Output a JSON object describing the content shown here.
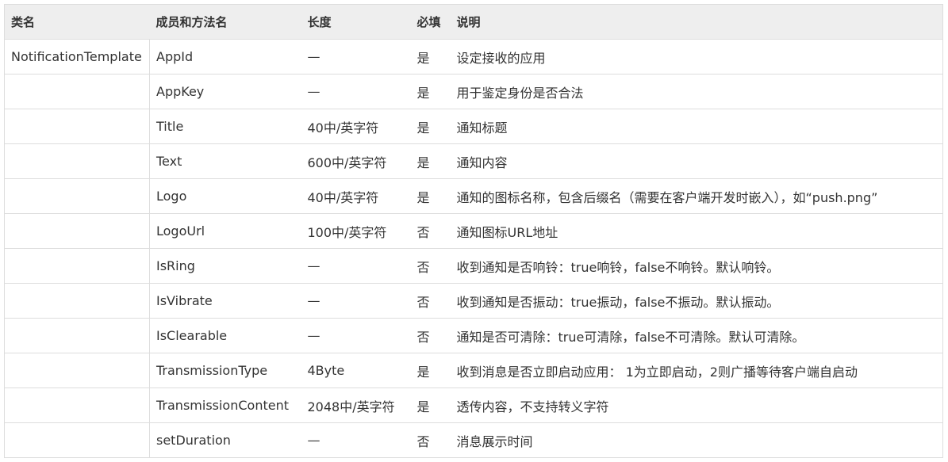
{
  "table": {
    "headers": [
      "类名",
      "成员和方法名",
      "长度",
      "必填",
      "说明"
    ],
    "rows": [
      {
        "class": "NotificationTemplate",
        "member": "AppId",
        "length": "—",
        "required": "是",
        "desc": "设定接收的应用"
      },
      {
        "class": "",
        "member": "AppKey",
        "length": "—",
        "required": "是",
        "desc": "用于鉴定身份是否合法"
      },
      {
        "class": "",
        "member": "Title",
        "length": "40中/英字符",
        "required": "是",
        "desc": "通知标题"
      },
      {
        "class": "",
        "member": "Text",
        "length": "600中/英字符",
        "required": "是",
        "desc": "通知内容"
      },
      {
        "class": "",
        "member": "Logo",
        "length": "40中/英字符",
        "required": "是",
        "desc": "通知的图标名称，包含后缀名（需要在客户端开发时嵌入），如“push.png”"
      },
      {
        "class": "",
        "member": "LogoUrl",
        "length": "100中/英字符",
        "required": "否",
        "desc": "通知图标URL地址"
      },
      {
        "class": "",
        "member": "IsRing",
        "length": "—",
        "required": "否",
        "desc": "收到通知是否响铃：true响铃，false不响铃。默认响铃。"
      },
      {
        "class": "",
        "member": "IsVibrate",
        "length": "—",
        "required": "否",
        "desc": "收到通知是否振动：true振动，false不振动。默认振动。"
      },
      {
        "class": "",
        "member": "IsClearable",
        "length": "—",
        "required": "否",
        "desc": "通知是否可清除：true可清除，false不可清除。默认可清除。"
      },
      {
        "class": "",
        "member": "TransmissionType",
        "length": "4Byte",
        "required": "是",
        "desc": "收到消息是否立即启动应用： 1为立即启动，2则广播等待客户端自启动"
      },
      {
        "class": "",
        "member": "TransmissionContent",
        "length": "2048中/英字符",
        "required": "是",
        "desc": "透传内容，不支持转义字符"
      },
      {
        "class": "",
        "member": "setDuration",
        "length": "—",
        "required": "否",
        "desc": "消息展示时间"
      }
    ]
  }
}
